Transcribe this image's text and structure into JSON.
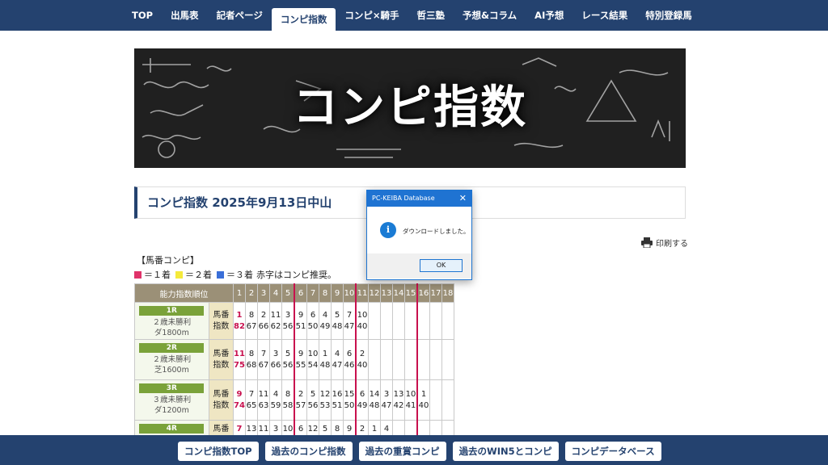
{
  "nav": {
    "items": [
      {
        "label": "TOP"
      },
      {
        "label": "出馬表"
      },
      {
        "label": "記者ページ"
      },
      {
        "label": "コンピ指数"
      },
      {
        "label": "コンピ×騎手"
      },
      {
        "label": "哲三塾"
      },
      {
        "label": "予想&コラム"
      },
      {
        "label": "AI予想"
      },
      {
        "label": "レース結果"
      },
      {
        "label": "特別登録馬"
      }
    ],
    "active": "コンピ指数"
  },
  "banner": {
    "title": "コンピ指数"
  },
  "heading": {
    "title": "コンピ指数 2025年9月13日中山"
  },
  "print": {
    "label": "印刷する",
    "icon": "printer-icon"
  },
  "legend": {
    "title": "【馬番コンピ】",
    "first_label": "＝１着",
    "second_label": "＝２着",
    "third_label": "＝３着",
    "note": "赤字はコンピ推奨。",
    "colors": {
      "first": "#e0336a",
      "second": "#f5ea3b",
      "third": "#3a6fd8"
    }
  },
  "table": {
    "header_label": "能力指数順位",
    "columns": [
      "1",
      "2",
      "3",
      "4",
      "5",
      "6",
      "7",
      "8",
      "9",
      "10",
      "11",
      "12",
      "13",
      "14",
      "15",
      "16",
      "17",
      "18"
    ],
    "horse_label": "馬番",
    "index_label": "指数",
    "races": [
      {
        "badge": "1R",
        "name1": "２歳未勝利",
        "name2": "ダ1800m",
        "horses": [
          "1",
          "8",
          "2",
          "11",
          "3",
          "9",
          "6",
          "4",
          "5",
          "7",
          "10",
          "",
          "",
          "",
          "",
          "",
          "",
          ""
        ],
        "indices": [
          "82",
          "67",
          "66",
          "62",
          "56",
          "51",
          "50",
          "49",
          "48",
          "47",
          "40",
          "",
          "",
          "",
          "",
          "",
          "",
          ""
        ]
      },
      {
        "badge": "2R",
        "name1": "２歳未勝利",
        "name2": "芝1600m",
        "horses": [
          "11",
          "8",
          "7",
          "3",
          "5",
          "9",
          "10",
          "1",
          "4",
          "6",
          "2",
          "",
          "",
          "",
          "",
          "",
          "",
          ""
        ],
        "indices": [
          "75",
          "68",
          "67",
          "66",
          "56",
          "55",
          "54",
          "48",
          "47",
          "46",
          "40",
          "",
          "",
          "",
          "",
          "",
          "",
          ""
        ]
      },
      {
        "badge": "3R",
        "name1": "３歳未勝利",
        "name2": "ダ1200m",
        "horses": [
          "9",
          "7",
          "11",
          "4",
          "8",
          "2",
          "5",
          "12",
          "16",
          "15",
          "6",
          "14",
          "3",
          "13",
          "10",
          "1",
          "",
          ""
        ],
        "indices": [
          "74",
          "65",
          "63",
          "59",
          "58",
          "57",
          "56",
          "53",
          "51",
          "50",
          "49",
          "48",
          "47",
          "42",
          "41",
          "40",
          "",
          ""
        ]
      },
      {
        "badge": "4R",
        "name1": "",
        "name2": "",
        "horses": [
          "7",
          "13",
          "11",
          "3",
          "10",
          "6",
          "12",
          "5",
          "8",
          "9",
          "2",
          "1",
          "4",
          "",
          "",
          "",
          "",
          ""
        ],
        "indices": [
          "",
          "",
          "",
          "",
          "",
          "",
          "",
          "",
          "",
          "",
          "",
          "",
          "",
          "",
          "",
          "",
          "",
          ""
        ]
      }
    ]
  },
  "dialog": {
    "title": "PC-KEIBA Database",
    "close": "✕",
    "icon": "info-icon",
    "message": "ダウンロードしました。",
    "ok_label": "OK"
  },
  "bottom": {
    "buttons": [
      {
        "label": "コンピ指数TOP"
      },
      {
        "label": "過去のコンピ指数"
      },
      {
        "label": "過去の重賞コンピ"
      },
      {
        "label": "過去のWIN5とコンピ"
      },
      {
        "label": "コンピデータベース"
      }
    ]
  }
}
